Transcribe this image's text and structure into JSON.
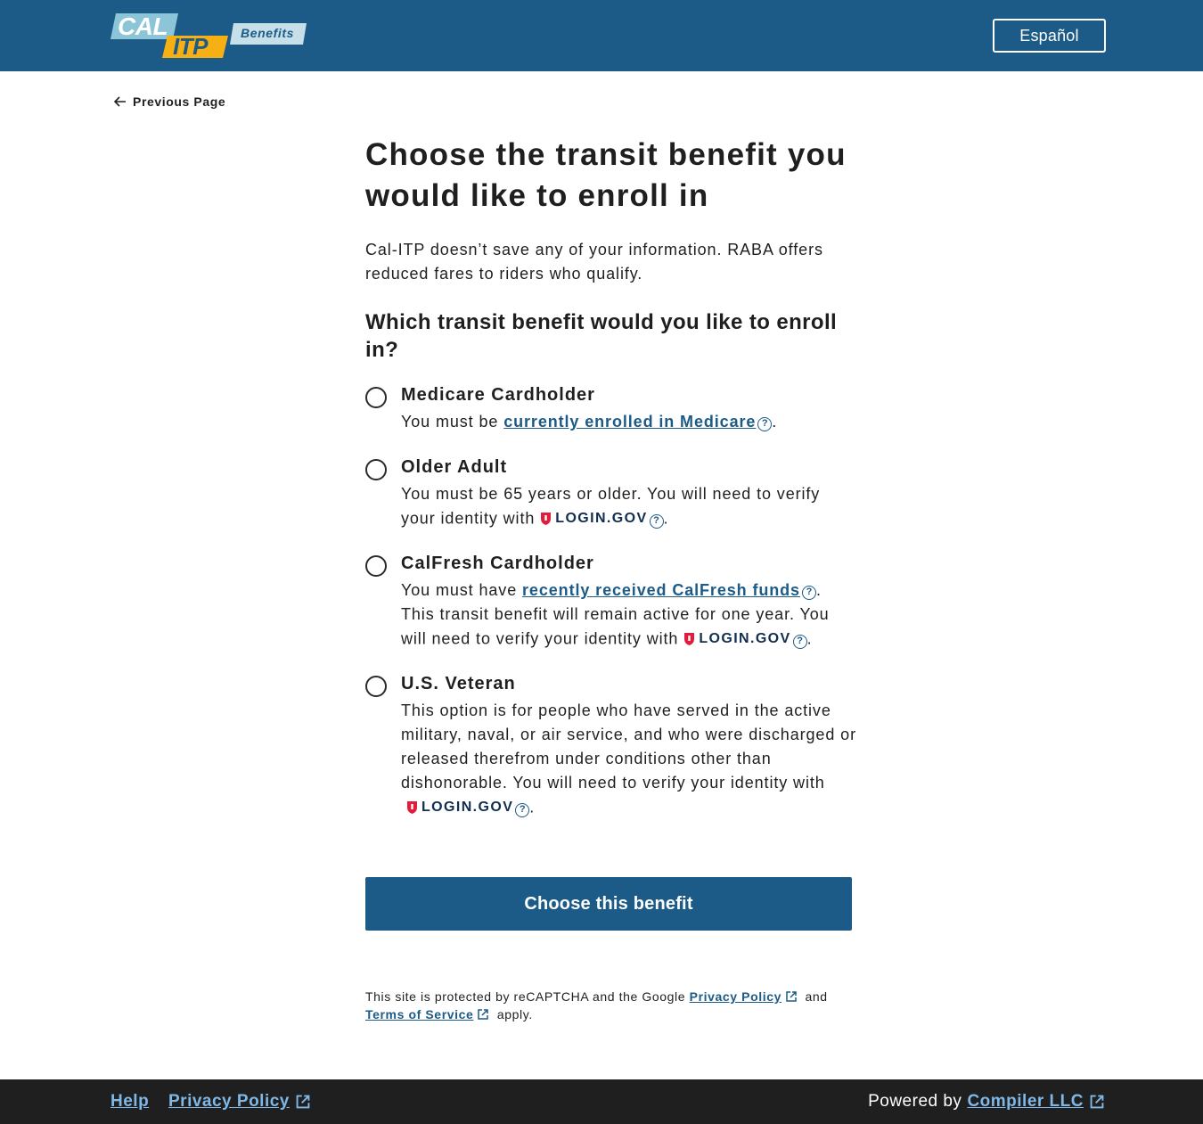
{
  "header": {
    "logo": {
      "word1": "CAL",
      "word2": "ITP",
      "word3": "Benefits"
    },
    "language_button": "Español"
  },
  "nav": {
    "previous_page": "Previous Page"
  },
  "main": {
    "title": "Choose the transit benefit you would like to enroll in",
    "intro": "Cal-ITP doesn’t save any of your information. RABA offers reduced fares to riders who qualify.",
    "question": "Which transit benefit would you like to enroll in?",
    "login_gov_label": "LOGIN.GOV",
    "options": [
      {
        "label": "Medicare Cardholder",
        "desc_before": "You must be ",
        "link": "currently enrolled in Medicare",
        "desc_after": "."
      },
      {
        "label": "Older Adult",
        "desc_before": "You must be 65 years or older. You will need to verify your identity with",
        "desc_after": "."
      },
      {
        "label": "CalFresh Cardholder",
        "desc_before": "You must have ",
        "link": "recently received CalFresh funds",
        "desc_middle": ". This transit benefit will remain active for one year. You will need to verify your identity with",
        "desc_after": "."
      },
      {
        "label": "U.S. Veteran",
        "desc_before": "This option is for people who have served in the active military, naval, or air service, and who were discharged or released therefrom under conditions other than dishonorable. You will need to verify your identity with",
        "desc_after": "."
      }
    ],
    "submit_button": "Choose this benefit",
    "recaptcha": {
      "text_before": "This site is protected by reCAPTCHA and the Google ",
      "privacy_link": "Privacy Policy",
      "text_and": " and",
      "terms_link": "Terms of Service",
      "text_after": " apply."
    }
  },
  "footer": {
    "help": "Help",
    "privacy": "Privacy Policy",
    "powered_by": "Powered by",
    "company": "Compiler LLC"
  },
  "colors": {
    "brand_blue": "#1c5b87",
    "logo_yellow": "#f6b014",
    "logo_light_blue": "#8cc4d8",
    "footer_bg": "#1f1f1f",
    "footer_link": "#7fb8e8",
    "login_gov_red": "#e21c3d",
    "login_gov_navy": "#112e51"
  }
}
